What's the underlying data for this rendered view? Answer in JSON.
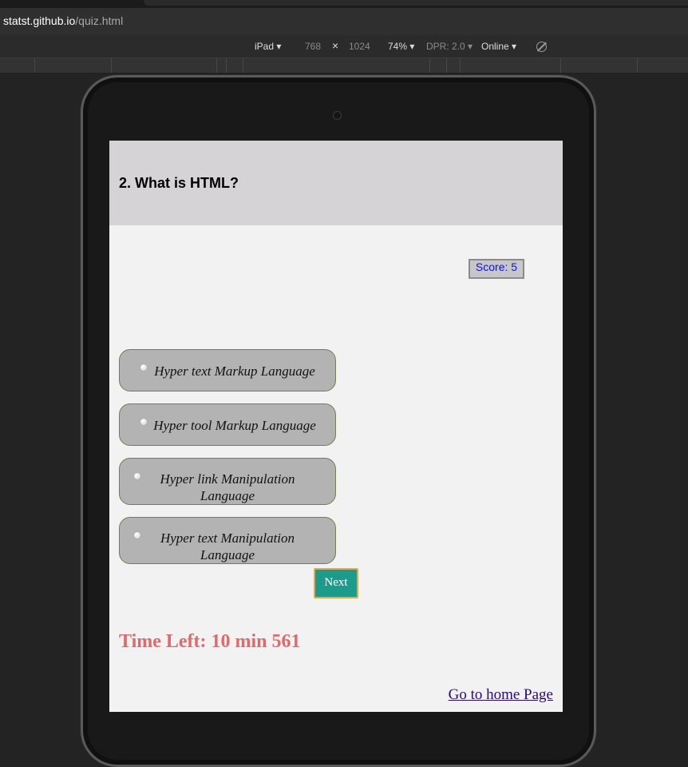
{
  "browser": {
    "url_host": "statst.github.io",
    "url_path": "/quiz.html"
  },
  "device_toolbar": {
    "device": "iPad",
    "width": "768",
    "times": "×",
    "height": "1024",
    "zoom": "74%",
    "dpr": "DPR: 2.0",
    "network": "Online",
    "dropdown_glyph": "▾",
    "rotate_icon": "rotate-icon"
  },
  "quiz": {
    "question": "2. What is HTML?",
    "score_label": "Score: 5",
    "options": [
      {
        "label": "Hyper text Markup Language"
      },
      {
        "label": "Hyper tool Markup Language"
      },
      {
        "label": "Hyper link Manipulation Language"
      },
      {
        "label": "Hyper text Manipulation Language"
      }
    ],
    "next_label": "Next",
    "timer": "Time Left: 10 min 561",
    "home_link": "Go to home Page"
  },
  "colors": {
    "header_bg": "#d5d3d6",
    "option_bg": "#b3b3b3",
    "option_border": "#6f8050",
    "next_bg": "#1c9a8c",
    "next_border": "#e8a94a",
    "timer_color": "#e06a6a",
    "score_text": "#1010f0",
    "link_color": "#2b0a7a"
  }
}
